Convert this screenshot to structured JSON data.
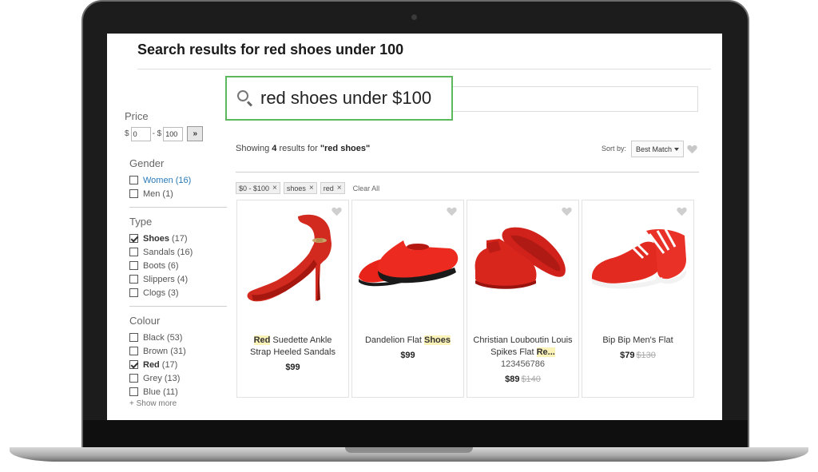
{
  "page": {
    "title": "Search results for red shoes under 100"
  },
  "search": {
    "query": "red shoes under $100"
  },
  "filters": {
    "price": {
      "title": "Price",
      "currency": "$",
      "min": "0",
      "separator": "- $",
      "max": "100",
      "go_label": "»"
    },
    "gender": {
      "title": "Gender",
      "items": [
        {
          "label": "Women",
          "count": "(16)"
        },
        {
          "label": "Men",
          "count": "(1)"
        }
      ]
    },
    "type": {
      "title": "Type",
      "items": [
        {
          "label": "Shoes",
          "count": "(17)"
        },
        {
          "label": "Sandals",
          "count": "(16)"
        },
        {
          "label": "Boots",
          "count": "(6)"
        },
        {
          "label": "Slippers",
          "count": "(4)"
        },
        {
          "label": "Clogs",
          "count": "(3)"
        }
      ]
    },
    "colour": {
      "title": "Colour",
      "items": [
        {
          "label": "Black",
          "count": "(53)"
        },
        {
          "label": "Brown",
          "count": "(31)"
        },
        {
          "label": "Red",
          "count": "(17)"
        },
        {
          "label": "Grey",
          "count": "(13)"
        },
        {
          "label": "Blue",
          "count": "(11)"
        }
      ],
      "show_more": "+ Show more"
    }
  },
  "results": {
    "prefix": "Showing",
    "count": "4",
    "middle": "results for",
    "query": "\"red shoes\"",
    "sort_label": "Sort by:",
    "sort_value": "Best Match"
  },
  "chips": {
    "items": [
      "$0 - $100",
      "shoes",
      "red"
    ],
    "remove_glyph": "×",
    "clear_all": "Clear All"
  },
  "products": [
    {
      "name_highlight": "Red",
      "name_rest": " Suedette Ankle Strap Heeled Sandals",
      "price": "$99",
      "was": ""
    },
    {
      "name_plain": "Dandelion Flat ",
      "name_highlight": "Shoes",
      "price": "$99",
      "was": ""
    },
    {
      "name_plain": "Christian Louboutin Louis Spikes Flat ",
      "name_highlight": "Re...",
      "sku": "123456786",
      "price": "$89",
      "was": "$140"
    },
    {
      "name_plain": "Bip Bip Men's Flat",
      "price": "$79",
      "was": "$130"
    }
  ],
  "colors": {
    "accent_green": "#5cb85c",
    "link_blue": "#2a7ab8",
    "highlight_yellow": "#fbf2b8",
    "product_red": "#e0231c"
  },
  "icons": {
    "search": "search-icon",
    "wishlist": "heart-icon",
    "remove": "close-icon",
    "sort": "chevron-down-icon"
  }
}
